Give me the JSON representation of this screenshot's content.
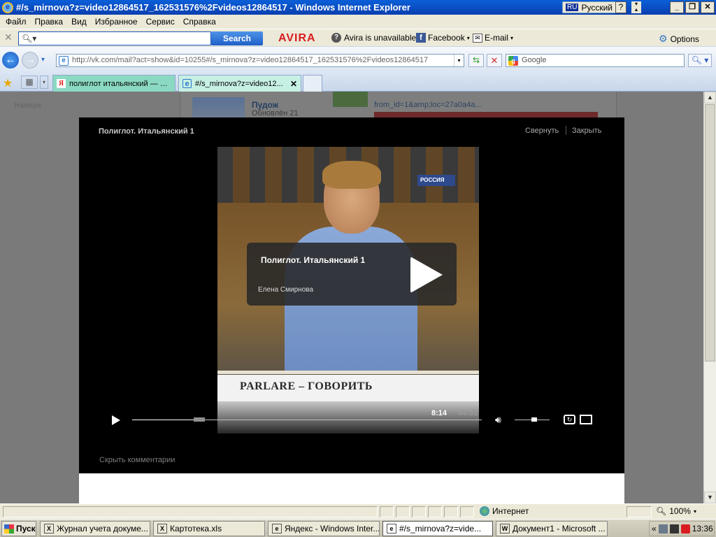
{
  "window": {
    "title": "#/s_mirnova?z=video12864517_162531576%2Fvideos12864517 - Windows Internet Explorer",
    "lang_code": "RU",
    "lang_name": "Русский",
    "help": "?",
    "btn_minimize": "_",
    "btn_restore": "❐",
    "btn_close": "✕"
  },
  "menu": [
    "Файл",
    "Правка",
    "Вид",
    "Избранное",
    "Сервис",
    "Справка"
  ],
  "avira_toolbar": {
    "search_button": "Search",
    "logo": "AVIRA",
    "status": "Avira is unavailable",
    "facebook": "Facebook",
    "email": "E-mail",
    "options": "Options"
  },
  "address_bar": {
    "url": "http://vk.com/mail?act=show&id=10255#/s_mirnova?z=video12864517_162531576%2Fvideos12864517",
    "search_placeholder": "Google"
  },
  "tabs": [
    {
      "label": "полиглот итальянский — Я...",
      "active": false
    },
    {
      "label": "#/s_mirnova?z=video12...",
      "active": true
    },
    {
      "label": "",
      "active": false
    }
  ],
  "vk_page": {
    "nav_up": "Наверх",
    "item_name": "Пудож",
    "item_updated": "Обновлён 21",
    "link_text": "from_id=1&amp;loc=27a0a4a..."
  },
  "video_modal": {
    "title": "Полиглот. Итальянский 1",
    "minimize_label": "Свернуть",
    "close_label": "Закрыть",
    "overlay_title": "Полиглот. Итальянский 1",
    "overlay_author": "Елена Смирнова",
    "channel_logo": "РОССИЯ",
    "caption": "PARLARE – ГОВОРИТЬ",
    "current_time": "8:14",
    "duration": "44:51",
    "progress_fraction": 0.183,
    "volume_fraction": 0.55,
    "hide_comments": "Скрыть комментарии"
  },
  "status_bar": {
    "zone": "Интернет",
    "zoom": "100%"
  },
  "taskbar": {
    "start": "Пуск",
    "tasks": [
      {
        "label": "Журнал учета докуме...",
        "icon": "X",
        "active": false
      },
      {
        "label": "Картотека.xls",
        "icon": "X",
        "active": false
      },
      {
        "label": "Яндекс - Windows Inter...",
        "icon": "e",
        "active": false
      },
      {
        "label": "#/s_mirnova?z=vide...",
        "icon": "e",
        "active": true
      },
      {
        "label": "Документ1 - Microsoft ...",
        "icon": "W",
        "active": false
      }
    ],
    "tray_expand": "«",
    "clock": "13:36"
  },
  "colors": {
    "titlebar": "#0a4fc8",
    "avira_red": "#d81c20",
    "modal_bg": "#000000",
    "page_dim": "#7a7a7a"
  }
}
